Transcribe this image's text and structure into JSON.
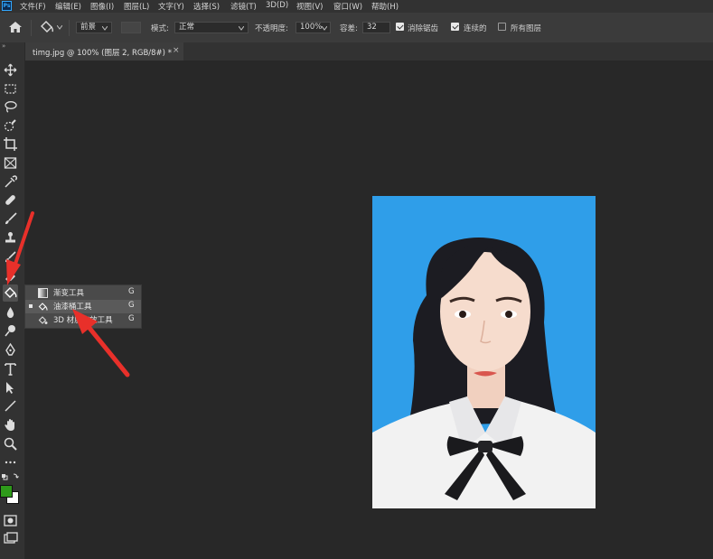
{
  "app": {
    "logo_text": "Ps"
  },
  "menu": [
    "文件(F)",
    "编辑(E)",
    "图像(I)",
    "图层(L)",
    "文字(Y)",
    "选择(S)",
    "滤镜(T)",
    "3D(D)",
    "视图(V)",
    "窗口(W)",
    "帮助(H)"
  ],
  "options": {
    "fill_source": "前景",
    "mode_label": "模式:",
    "mode_value": "正常",
    "opacity_label": "不透明度:",
    "opacity_value": "100%",
    "tolerance_label": "容差:",
    "tolerance_value": "32",
    "antialias_label": "消除锯齿",
    "antialias_checked": true,
    "contiguous_label": "连续的",
    "contiguous_checked": true,
    "all_layers_label": "所有图层",
    "all_layers_checked": false
  },
  "document_tab": {
    "title": "timg.jpg @ 100% (图层 2, RGB/8#) *",
    "close": "×"
  },
  "flyout": [
    {
      "label": "渐变工具",
      "key": "G",
      "selected": false,
      "icon": "gradient-tool-icon"
    },
    {
      "label": "油漆桶工具",
      "key": "G",
      "selected": true,
      "icon": "paint-bucket-icon"
    },
    {
      "label": "3D 材质拖放工具",
      "key": "G",
      "selected": false,
      "icon": "3d-material-drop-icon"
    }
  ],
  "colors": {
    "foreground": "#2e9a1a",
    "background": "#ffffff",
    "photo_background": "#2d9ce8",
    "arrow": "#e8302a"
  }
}
